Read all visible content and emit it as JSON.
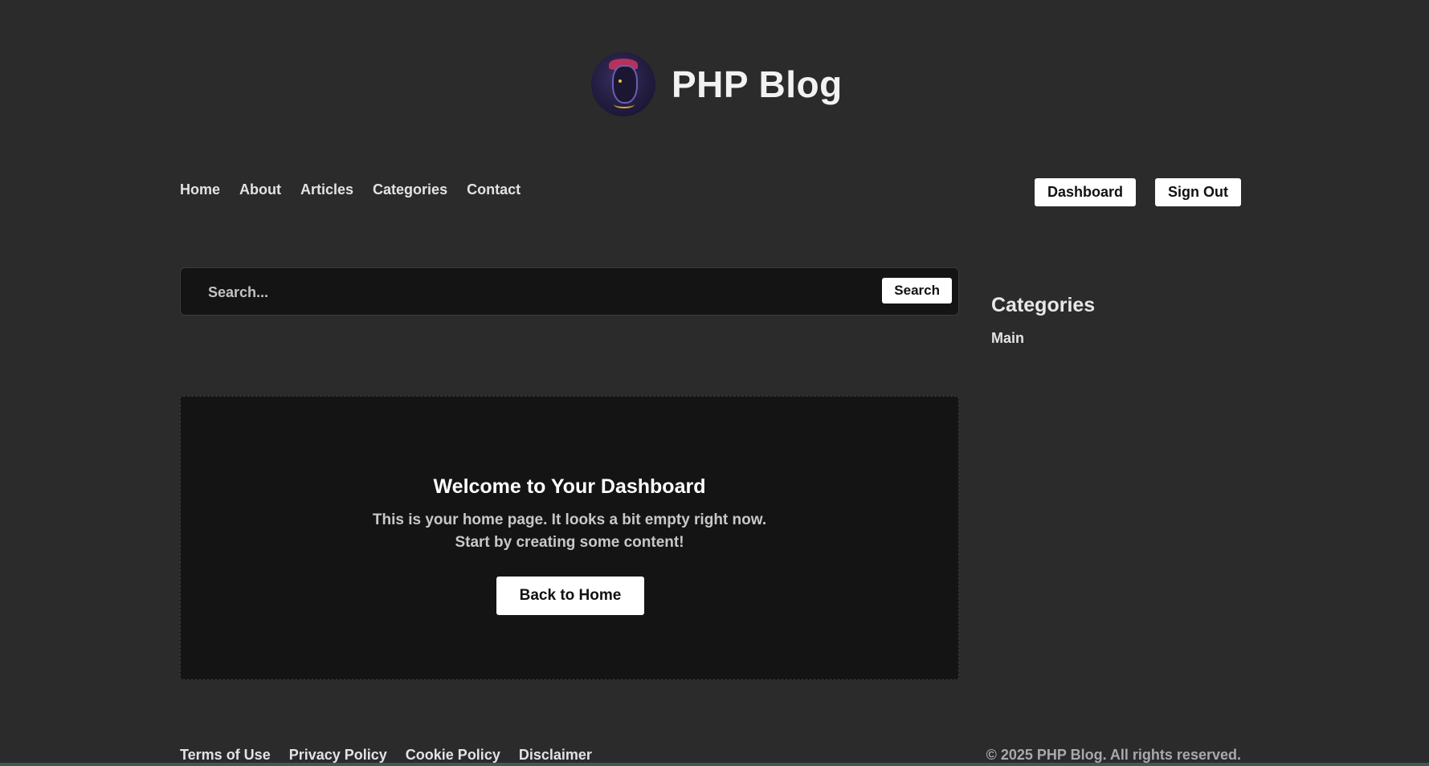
{
  "header": {
    "site_title": "PHP Blog",
    "logo_icon": "avatar-logo-icon"
  },
  "nav": {
    "items": [
      "Home",
      "About",
      "Articles",
      "Categories",
      "Contact"
    ],
    "dashboard_label": "Dashboard",
    "sign_out_label": "Sign Out"
  },
  "search": {
    "placeholder": "Search...",
    "value": "",
    "button_label": "Search"
  },
  "sidebar": {
    "heading": "Categories",
    "categories": [
      "Main"
    ]
  },
  "welcome": {
    "title": "Welcome to Your Dashboard",
    "line1": "This is your home page. It looks a bit empty right now.",
    "line2": "Start by creating some content!",
    "button_label": "Back to Home"
  },
  "footer": {
    "links": [
      "Terms of Use",
      "Privacy Policy",
      "Cookie Policy",
      "Disclaimer"
    ],
    "copyright": "© 2025 PHP Blog. All rights reserved."
  },
  "colors": {
    "background": "#2b2b2b",
    "panel": "#141414",
    "button_bg": "#ffffff",
    "text": "#e6e6e6"
  }
}
